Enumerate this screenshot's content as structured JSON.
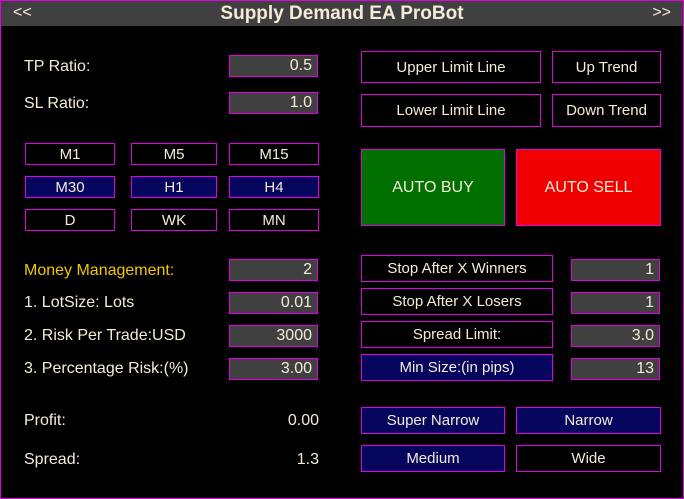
{
  "header": {
    "title": "Supply Demand EA ProBot",
    "left_nav": "<<",
    "right_nav": ">>"
  },
  "fields": {
    "tp_label": "TP Ratio:",
    "tp_value": "0.5",
    "sl_label": "SL Ratio:",
    "sl_value": "1.0"
  },
  "timeframes": [
    {
      "label": "M1",
      "active": false
    },
    {
      "label": "M5",
      "active": false
    },
    {
      "label": "M15",
      "active": false
    },
    {
      "label": "M30",
      "active": true
    },
    {
      "label": "H1",
      "active": true
    },
    {
      "label": "H4",
      "active": true
    },
    {
      "label": "D",
      "active": false
    },
    {
      "label": "WK",
      "active": false
    },
    {
      "label": "MN",
      "active": false
    }
  ],
  "lines": {
    "upper": "Upper Limit Line",
    "lower": "Lower Limit Line",
    "up_trend": "Up Trend",
    "down_trend": "Down Trend"
  },
  "auto": {
    "buy": "AUTO BUY",
    "sell": "AUTO SELL",
    "buy_color": "#007000",
    "sell_color": "#f00000"
  },
  "money": {
    "title": "Money Management:",
    "title_value": "2",
    "lot_label": "1. LotSize: Lots",
    "lot_value": "0.01",
    "risk_label": "2. Risk Per Trade:USD",
    "risk_value": "3000",
    "pct_label": "3. Percentage Risk:(%)",
    "pct_value": "3.00"
  },
  "stops": {
    "winners": "Stop After X Winners",
    "winners_value": "1",
    "losers": "Stop After X Losers",
    "losers_value": "1",
    "spread": "Spread Limit:",
    "spread_value": "3.0",
    "minsize": "Min Size:(in pips)",
    "minsize_value": "13"
  },
  "stats": {
    "profit_label": "Profit:",
    "profit_value": "0.00",
    "spread_label": "Spread:",
    "spread_value": "1.3"
  },
  "zones": {
    "super_narrow": "Super Narrow",
    "narrow": "Narrow",
    "medium": "Medium",
    "wide": "Wide"
  }
}
